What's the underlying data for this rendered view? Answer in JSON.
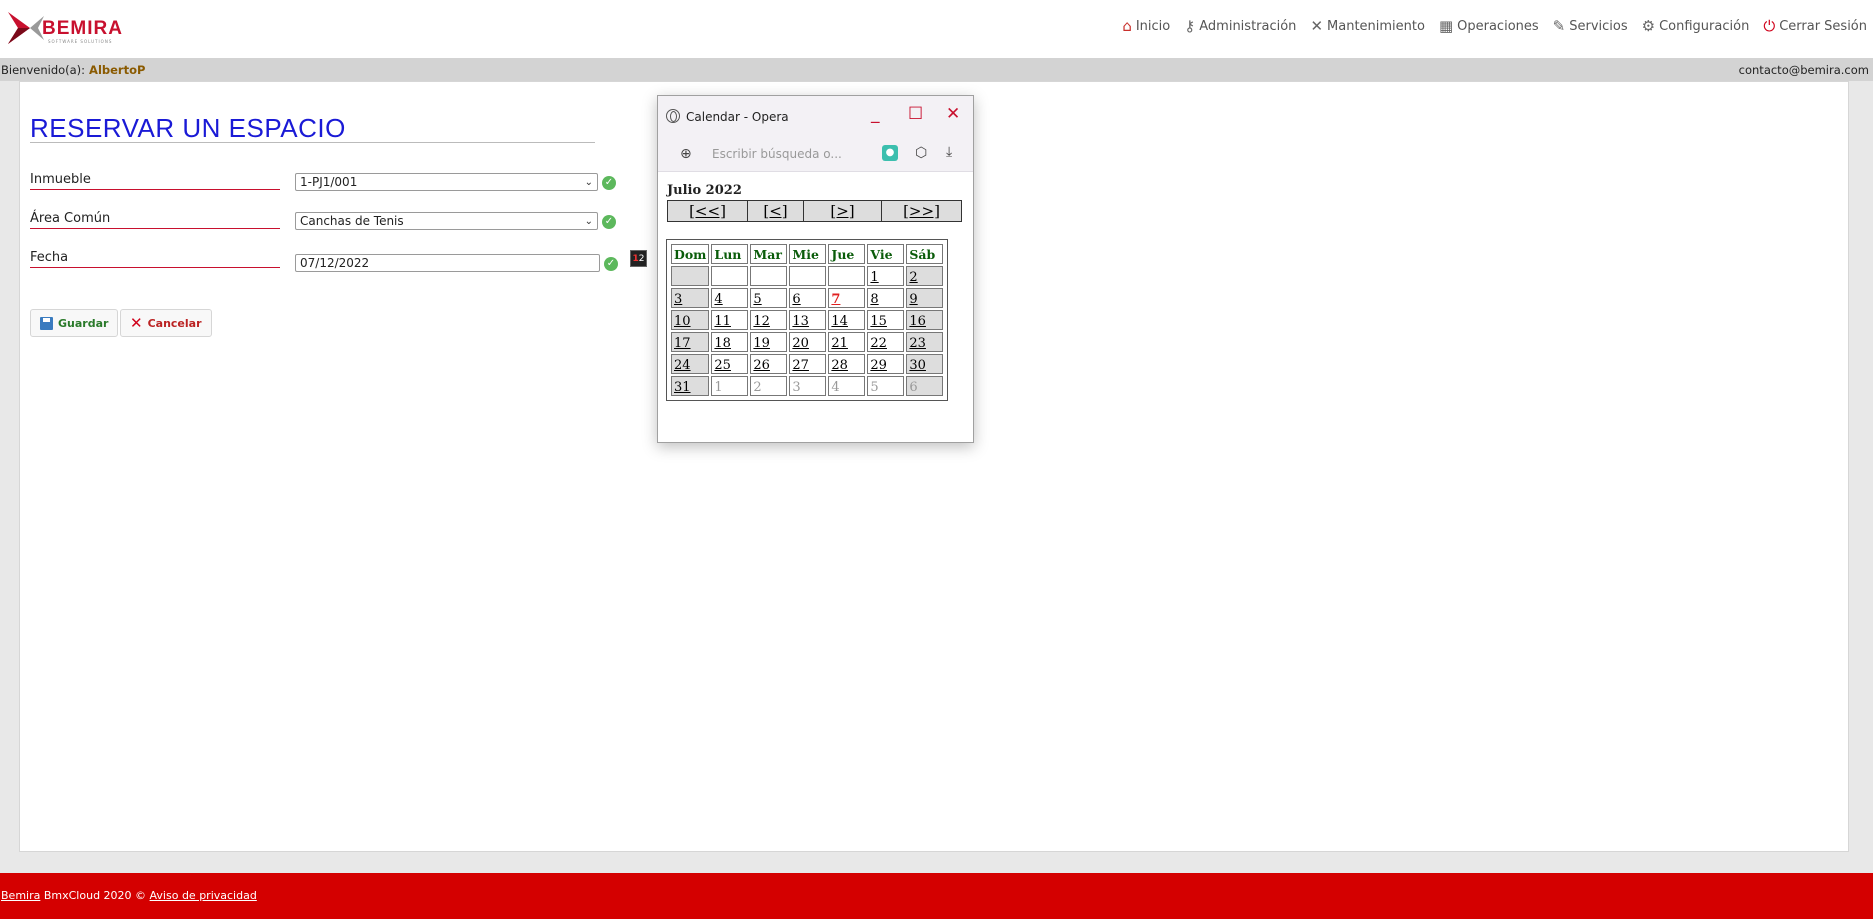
{
  "header": {
    "logo_text": "BEMIRA",
    "logo_sub": "SOFTWARE SOLUTIONS",
    "nav": [
      {
        "label": "Inicio",
        "icon": "home-icon"
      },
      {
        "label": "Administración",
        "icon": "key-icon"
      },
      {
        "label": "Mantenimiento",
        "icon": "tools-icon"
      },
      {
        "label": "Operaciones",
        "icon": "calculator-icon"
      },
      {
        "label": "Servicios",
        "icon": "document-icon"
      },
      {
        "label": "Configuración",
        "icon": "gear-icon"
      },
      {
        "label": "Cerrar Sesión",
        "icon": "power-icon"
      }
    ]
  },
  "welcome": {
    "prefix": "Bienvenido(a):",
    "user": "AlbertoP",
    "contact": "contacto@bemira.com"
  },
  "form": {
    "title": "RESERVAR UN ESPACIO",
    "inmueble_label": "Inmueble",
    "inmueble_value": "1-PJ1/001",
    "area_label": "Área Común",
    "area_value": "Canchas de Tenis",
    "fecha_label": "Fecha",
    "fecha_value": "07/12/2022",
    "save_label": "Guardar",
    "cancel_label": "Cancelar"
  },
  "footer": {
    "brand": "Bemira",
    "copyright": " BmxCloud 2020 © ",
    "privacy": "Aviso de privacidad"
  },
  "popup": {
    "window_title": "Calendar - Opera",
    "address_placeholder": "Escribir búsqueda o...",
    "month_title": "Julio 2022",
    "nav": [
      "[<<]",
      "[<]",
      "[>]",
      "[>>]"
    ],
    "weekdays": [
      "Dom",
      "Lun",
      "Mar",
      "Mie",
      "Jue",
      "Vie",
      "Sáb"
    ],
    "today": "7",
    "weeks": [
      [
        {
          "d": "",
          "cur": true
        },
        {
          "d": "",
          "cur": true
        },
        {
          "d": "",
          "cur": true
        },
        {
          "d": "",
          "cur": true
        },
        {
          "d": "",
          "cur": true
        },
        {
          "d": "1",
          "cur": true
        },
        {
          "d": "2",
          "cur": true
        }
      ],
      [
        {
          "d": "3",
          "cur": true
        },
        {
          "d": "4",
          "cur": true
        },
        {
          "d": "5",
          "cur": true
        },
        {
          "d": "6",
          "cur": true
        },
        {
          "d": "7",
          "cur": true
        },
        {
          "d": "8",
          "cur": true
        },
        {
          "d": "9",
          "cur": true
        }
      ],
      [
        {
          "d": "10",
          "cur": true
        },
        {
          "d": "11",
          "cur": true
        },
        {
          "d": "12",
          "cur": true
        },
        {
          "d": "13",
          "cur": true
        },
        {
          "d": "14",
          "cur": true
        },
        {
          "d": "15",
          "cur": true
        },
        {
          "d": "16",
          "cur": true
        }
      ],
      [
        {
          "d": "17",
          "cur": true
        },
        {
          "d": "18",
          "cur": true
        },
        {
          "d": "19",
          "cur": true
        },
        {
          "d": "20",
          "cur": true
        },
        {
          "d": "21",
          "cur": true
        },
        {
          "d": "22",
          "cur": true
        },
        {
          "d": "23",
          "cur": true
        }
      ],
      [
        {
          "d": "24",
          "cur": true
        },
        {
          "d": "25",
          "cur": true
        },
        {
          "d": "26",
          "cur": true
        },
        {
          "d": "27",
          "cur": true
        },
        {
          "d": "28",
          "cur": true
        },
        {
          "d": "29",
          "cur": true
        },
        {
          "d": "30",
          "cur": true
        }
      ],
      [
        {
          "d": "31",
          "cur": true
        },
        {
          "d": "1",
          "cur": false
        },
        {
          "d": "2",
          "cur": false
        },
        {
          "d": "3",
          "cur": false
        },
        {
          "d": "4",
          "cur": false
        },
        {
          "d": "5",
          "cur": false
        },
        {
          "d": "6",
          "cur": false
        }
      ]
    ]
  },
  "colors": {
    "brand_red": "#d40000",
    "title_blue": "#1a1ad6",
    "weekday_green": "#0a5c0a",
    "today_red": "#e02020"
  }
}
